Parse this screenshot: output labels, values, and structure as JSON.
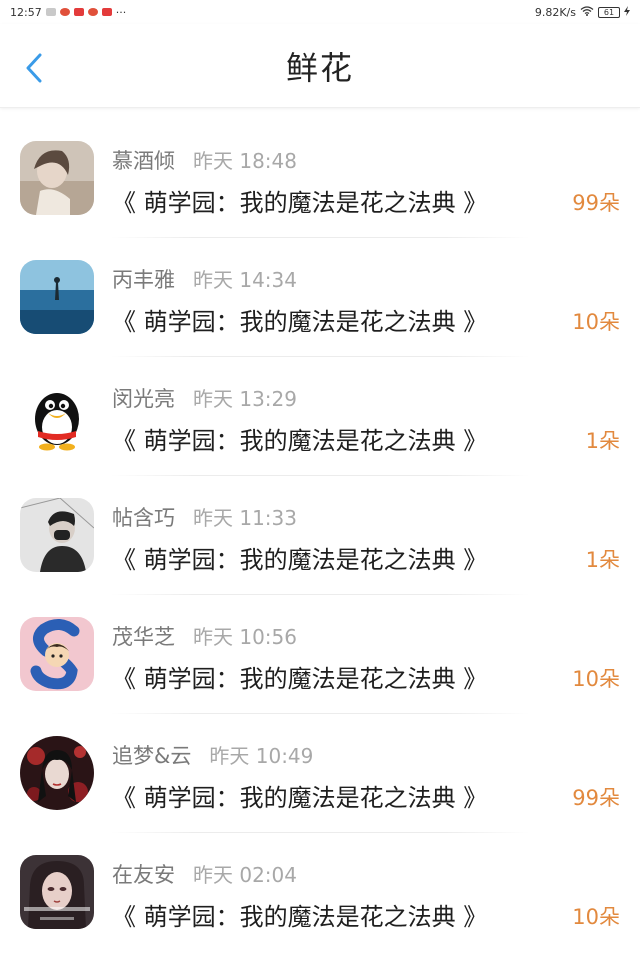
{
  "status_bar": {
    "time": "12:57",
    "dots": "···",
    "network_speed": "9.82K/s",
    "battery": "61"
  },
  "header": {
    "title": "鲜花",
    "back_icon": "chevron-left-icon"
  },
  "items": [
    {
      "user": "慕酒倾",
      "time": "昨天 18:48",
      "book": "《 萌学园：我的魔法是花之法典 》",
      "count": "99朵"
    },
    {
      "user": "丙丰雅",
      "time": "昨天 14:34",
      "book": "《 萌学园：我的魔法是花之法典 》",
      "count": "10朵"
    },
    {
      "user": "闵光亮",
      "time": "昨天 13:29",
      "book": "《 萌学园：我的魔法是花之法典 》",
      "count": "1朵"
    },
    {
      "user": "帖含巧",
      "time": "昨天 11:33",
      "book": "《 萌学园：我的魔法是花之法典 》",
      "count": "1朵"
    },
    {
      "user": "茂华芝",
      "time": "昨天 10:56",
      "book": "《 萌学园：我的魔法是花之法典 》",
      "count": "10朵"
    },
    {
      "user": "追梦&云",
      "time": "昨天 10:49",
      "book": "《 萌学园：我的魔法是花之法典 》",
      "count": "99朵"
    },
    {
      "user": "在友安",
      "time": "昨天 02:04",
      "book": "《 萌学园：我的魔法是花之法典 》",
      "count": "10朵"
    }
  ],
  "colors": {
    "accent_back": "#3a9be8",
    "count": "#e2893e"
  }
}
